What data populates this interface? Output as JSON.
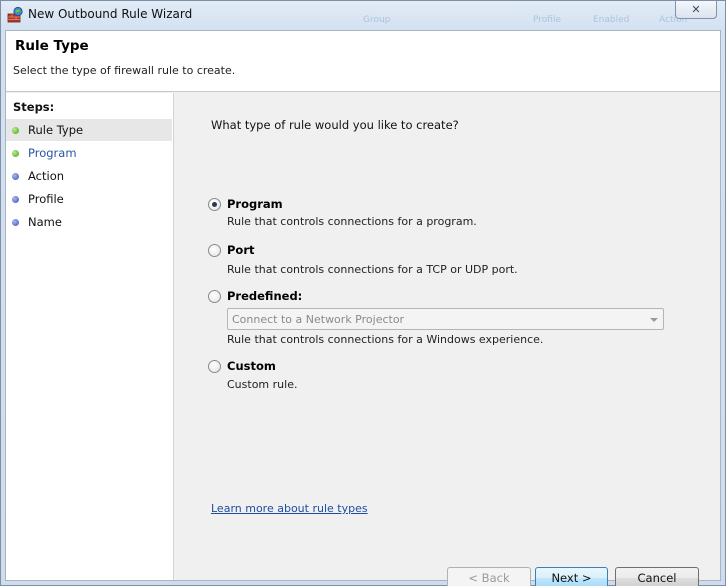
{
  "window": {
    "title": "New Outbound Rule Wizard",
    "close_symbol": "✕",
    "ghost_labels": [
      "Group",
      "Profile",
      "Enabled",
      "Action"
    ]
  },
  "header": {
    "title": "Rule Type",
    "subtitle": "Select the type of firewall rule to create."
  },
  "steps": {
    "heading": "Steps:",
    "items": [
      {
        "label": "Rule Type",
        "status": "current",
        "dot_color": "green"
      },
      {
        "label": "Program",
        "status": "next",
        "dot_color": "green"
      },
      {
        "label": "Action",
        "status": "pending",
        "dot_color": "blue"
      },
      {
        "label": "Profile",
        "status": "pending",
        "dot_color": "blue"
      },
      {
        "label": "Name",
        "status": "pending",
        "dot_color": "blue"
      }
    ]
  },
  "main": {
    "question": "What type of rule would you like to create?",
    "options": [
      {
        "title": "Program",
        "description": "Rule that controls connections for a program.",
        "selected": true
      },
      {
        "title": "Port",
        "description": "Rule that controls connections for a TCP or UDP port.",
        "selected": false
      },
      {
        "title": "Predefined:",
        "description": "Rule that controls connections for a Windows experience.",
        "selected": false
      },
      {
        "title": "Custom",
        "description": "Custom rule.",
        "selected": false
      }
    ],
    "predefined_select": {
      "value": "Connect to a Network Projector",
      "enabled": false
    },
    "learn_more_link": "Learn more about rule types"
  },
  "buttons": {
    "back": "< Back",
    "next": "Next >",
    "cancel": "Cancel"
  },
  "colors": {
    "accent_link": "#1e4ea0",
    "step_green": "#3ea11f",
    "step_blue": "#3a4fb8"
  }
}
